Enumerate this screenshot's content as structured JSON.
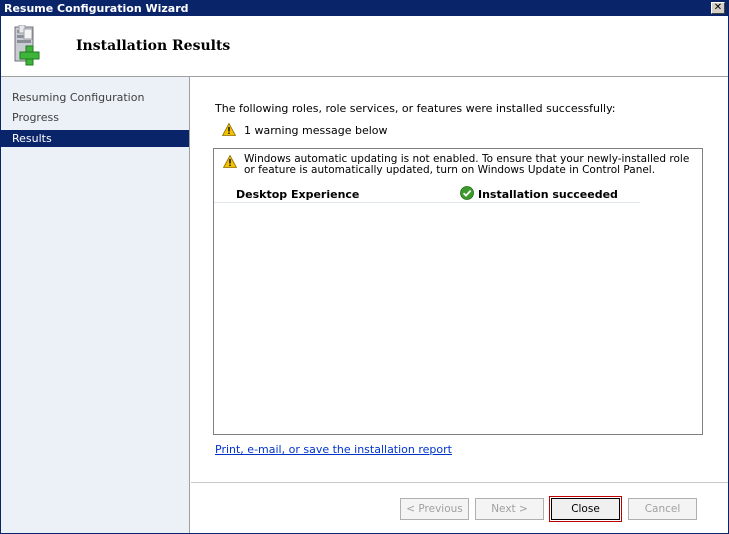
{
  "window": {
    "title": "Resume Configuration Wizard",
    "close_glyph": "✕"
  },
  "header": {
    "title": "Installation Results",
    "icon": "server-add-icon"
  },
  "sidebar": {
    "items": [
      {
        "label": "Resuming Configuration",
        "active": false
      },
      {
        "label": "Progress",
        "active": false
      },
      {
        "label": "Results",
        "active": true
      }
    ]
  },
  "content": {
    "intro": "The following roles, role services, or features were installed successfully:",
    "warning_summary": "1 warning message below",
    "warning_detail": "Windows automatic updating is not enabled. To ensure that your newly-installed role or feature is automatically updated, turn on Windows Update in Control Panel.",
    "results": [
      {
        "name": "Desktop Experience",
        "status": "Installation succeeded",
        "status_icon": "success-check-icon"
      }
    ],
    "report_link": "Print, e-mail, or save the installation report"
  },
  "buttons": {
    "previous": "< Previous",
    "next": "Next >",
    "close": "Close",
    "cancel": "Cancel"
  },
  "colors": {
    "title_bar": "#0a246a",
    "sidebar_bg": "#ecf1f8",
    "active_item": "#0a246a",
    "link": "#0033cc",
    "focus_outline": "#c00000",
    "success": "#3c9a2c",
    "warning": "#f2c200"
  }
}
